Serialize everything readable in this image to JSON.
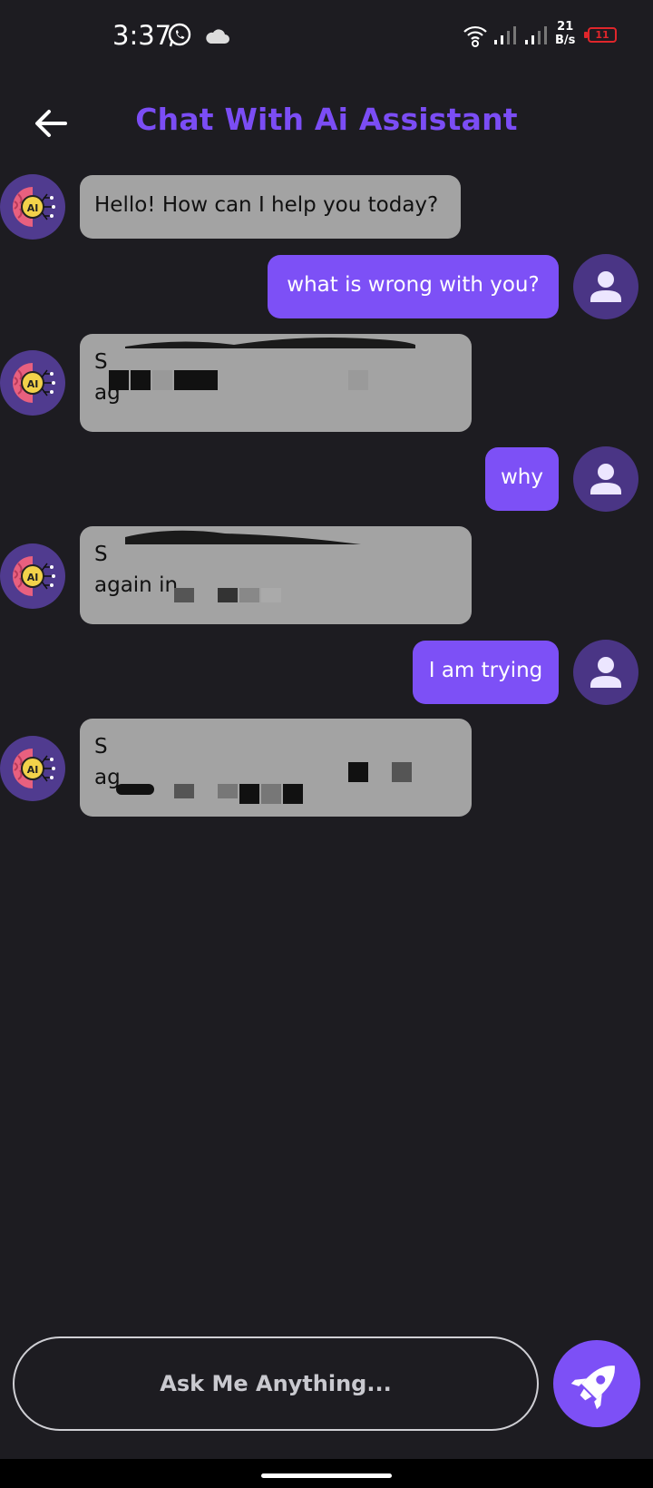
{
  "status_bar": {
    "time": "3:37",
    "net_speed_value": "21",
    "net_speed_unit": "B/s",
    "battery": "11",
    "icons": [
      "whatsapp-icon",
      "cloud-icon",
      "wifi-icon",
      "signal-icon",
      "signal-icon",
      "battery-icon"
    ]
  },
  "header": {
    "title": "Chat With Ai Assistant",
    "back_icon": "arrow-left-icon"
  },
  "messages": [
    {
      "sender": "bot",
      "text": "Hello! How can I help you today?"
    },
    {
      "sender": "user",
      "text": "what is wrong with you?"
    },
    {
      "sender": "bot",
      "line1": "S",
      "line2": "ag"
    },
    {
      "sender": "user",
      "text": "why"
    },
    {
      "sender": "bot",
      "line1": "S",
      "line2": "again in"
    },
    {
      "sender": "user",
      "text": "I am trying"
    },
    {
      "sender": "bot",
      "line1": "S",
      "line2": "ag"
    }
  ],
  "input": {
    "placeholder": "Ask Me Anything...",
    "send_icon": "rocket-icon"
  },
  "colors": {
    "background": "#1d1c21",
    "accent": "#7d50f6",
    "bot_bubble": "#a3a3a3",
    "avatar_bg": "#503b8f"
  }
}
